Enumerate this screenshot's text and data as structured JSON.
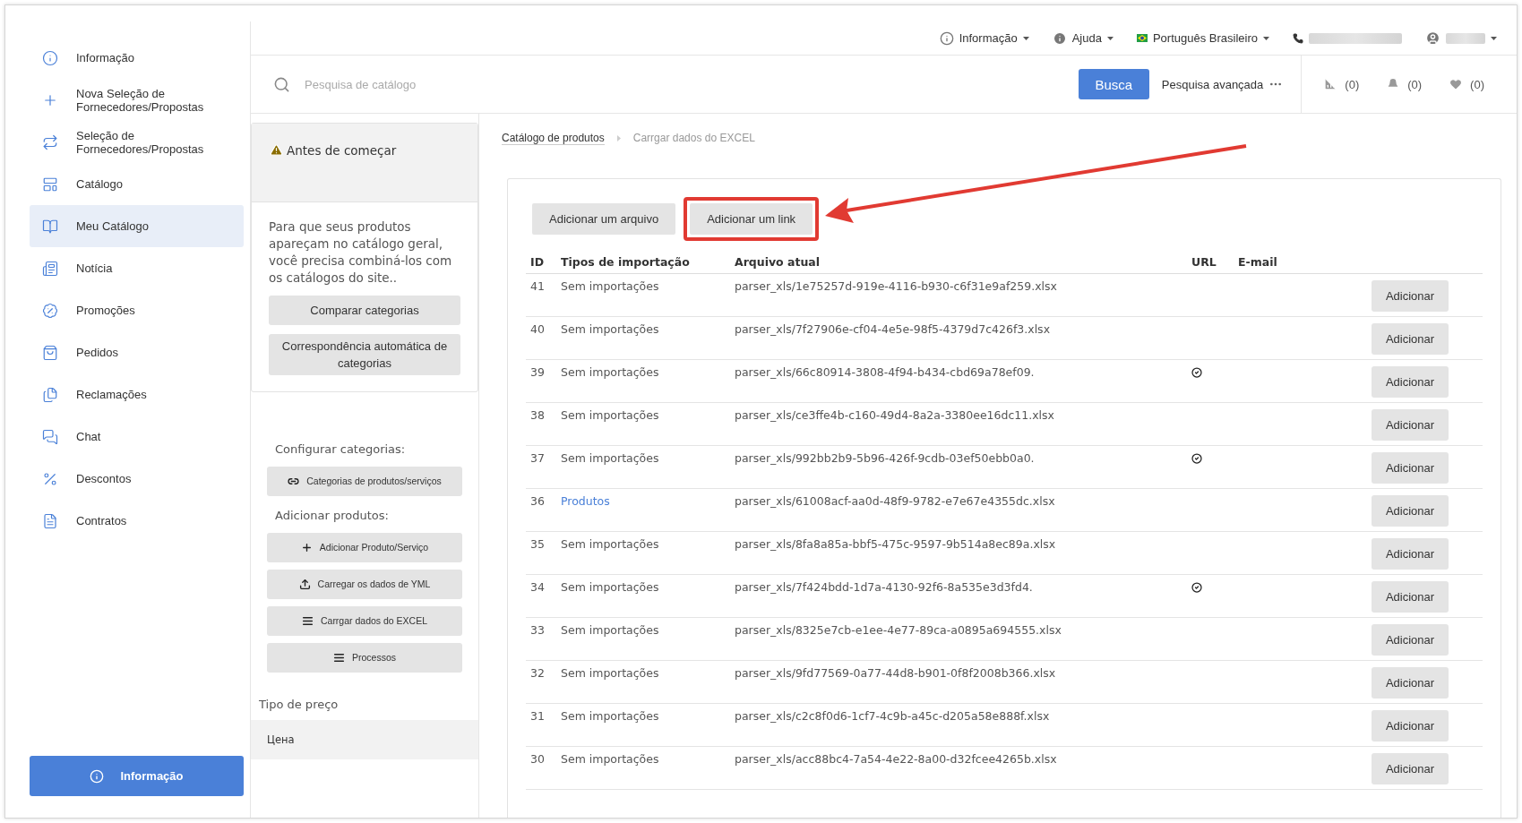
{
  "sidebar": {
    "items": [
      {
        "label": "Informação",
        "selected": false
      },
      {
        "label": "Nova Seleção de Fornecedores/Propostas",
        "selected": false
      },
      {
        "label": "Seleção de Fornecedores/Propostas",
        "selected": false
      },
      {
        "label": "Catálogo",
        "selected": false
      },
      {
        "label": "Meu Catálogo",
        "selected": true
      },
      {
        "label": "Notícia",
        "selected": false
      },
      {
        "label": "Promoções",
        "selected": false
      },
      {
        "label": "Pedidos",
        "selected": false
      },
      {
        "label": "Reclamações",
        "selected": false
      },
      {
        "label": "Chat",
        "selected": false
      },
      {
        "label": "Descontos",
        "selected": false
      },
      {
        "label": "Contratos",
        "selected": false
      }
    ],
    "footer_button": "Informação"
  },
  "top_bar": {
    "menus": [
      "Informação",
      "Ajuda",
      "Português Brasileiro"
    ]
  },
  "search": {
    "placeholder": "Pesquisa de catálogo",
    "button": "Busca",
    "advanced": "Pesquisa avançada",
    "counters": [
      "(0)",
      "(0)",
      "(0)"
    ]
  },
  "intro_card": {
    "title": "Antes de começar",
    "text": "Para que seus produtos apareçam no catálogo geral, você precisa combiná-los com os catálogos do site..",
    "buttons": [
      "Comparar categorias",
      "Correspondência automática de categorias"
    ]
  },
  "tools": {
    "sections": [
      {
        "heading": "Configurar categorias:",
        "buttons": [
          "Categorias de produtos/serviços"
        ]
      },
      {
        "heading": "Adicionar produtos:",
        "buttons": [
          "Adicionar Produto/Serviço",
          "Carregar os dados de YML",
          "Carrgar dados do EXCEL",
          "Processos"
        ]
      }
    ]
  },
  "price_type": {
    "heading": "Tipo de preço",
    "options": [
      "Цена"
    ]
  },
  "breadcrumb": [
    "Catálogo de produtos",
    "Carrgar dados do EXCEL"
  ],
  "actions": [
    {
      "label": "Adicionar um arquivo",
      "highlighted": false
    },
    {
      "label": "Adicionar um link",
      "highlighted": true
    }
  ],
  "table": {
    "columns": [
      "ID",
      "Tipos de importação",
      "Arquivo atual",
      "URL",
      "E-mail"
    ],
    "rows": [
      {
        "id": "41",
        "type": "Sem importações",
        "link": false,
        "file": "parser_xls/1e75257d-919e-4116-b930-c6f31e9af259.xlsx",
        "url": false,
        "action": "Adicionar"
      },
      {
        "id": "40",
        "type": "Sem importações",
        "link": false,
        "file": "parser_xls/7f27906e-cf04-4e5e-98f5-4379d7c426f3.xlsx",
        "url": false,
        "action": "Adicionar"
      },
      {
        "id": "39",
        "type": "Sem importações",
        "link": false,
        "file": "parser_xls/66c80914-3808-4f94-b434-cbd69a78ef09.",
        "url": true,
        "action": "Adicionar"
      },
      {
        "id": "38",
        "type": "Sem importações",
        "link": false,
        "file": "parser_xls/ce3ffe4b-c160-49d4-8a2a-3380ee16dc11.xlsx",
        "url": false,
        "action": "Adicionar"
      },
      {
        "id": "37",
        "type": "Sem importações",
        "link": false,
        "file": "parser_xls/992bb2b9-5b96-426f-9cdb-03ef50ebb0a0.",
        "url": true,
        "action": "Adicionar"
      },
      {
        "id": "36",
        "type": "Produtos",
        "link": true,
        "file": "parser_xls/61008acf-aa0d-48f9-9782-e7e67e4355dc.xlsx",
        "url": false,
        "action": "Adicionar"
      },
      {
        "id": "35",
        "type": "Sem importações",
        "link": false,
        "file": "parser_xls/8fa8a85a-bbf5-475c-9597-9b514a8ec89a.xlsx",
        "url": false,
        "action": "Adicionar"
      },
      {
        "id": "34",
        "type": "Sem importações",
        "link": false,
        "file": "parser_xls/7f424bdd-1d7a-4130-92f6-8a535e3d3fd4.",
        "url": true,
        "action": "Adicionar"
      },
      {
        "id": "33",
        "type": "Sem importações",
        "link": false,
        "file": "parser_xls/8325e7cb-e1ee-4e77-89ca-a0895a694555.xlsx",
        "url": false,
        "action": "Adicionar"
      },
      {
        "id": "32",
        "type": "Sem importações",
        "link": false,
        "file": "parser_xls/9fd77569-0a77-44d8-b901-0f8f2008b366.xlsx",
        "url": false,
        "action": "Adicionar"
      },
      {
        "id": "31",
        "type": "Sem importações",
        "link": false,
        "file": "parser_xls/c2c8f0d6-1cf7-4c9b-a45c-d205a58e888f.xlsx",
        "url": false,
        "action": "Adicionar"
      },
      {
        "id": "30",
        "type": "Sem importações",
        "link": false,
        "file": "parser_xls/acc88bc4-7a54-4e22-8a00-d32fcee4265b.xlsx",
        "url": false,
        "action": "Adicionar"
      }
    ]
  }
}
